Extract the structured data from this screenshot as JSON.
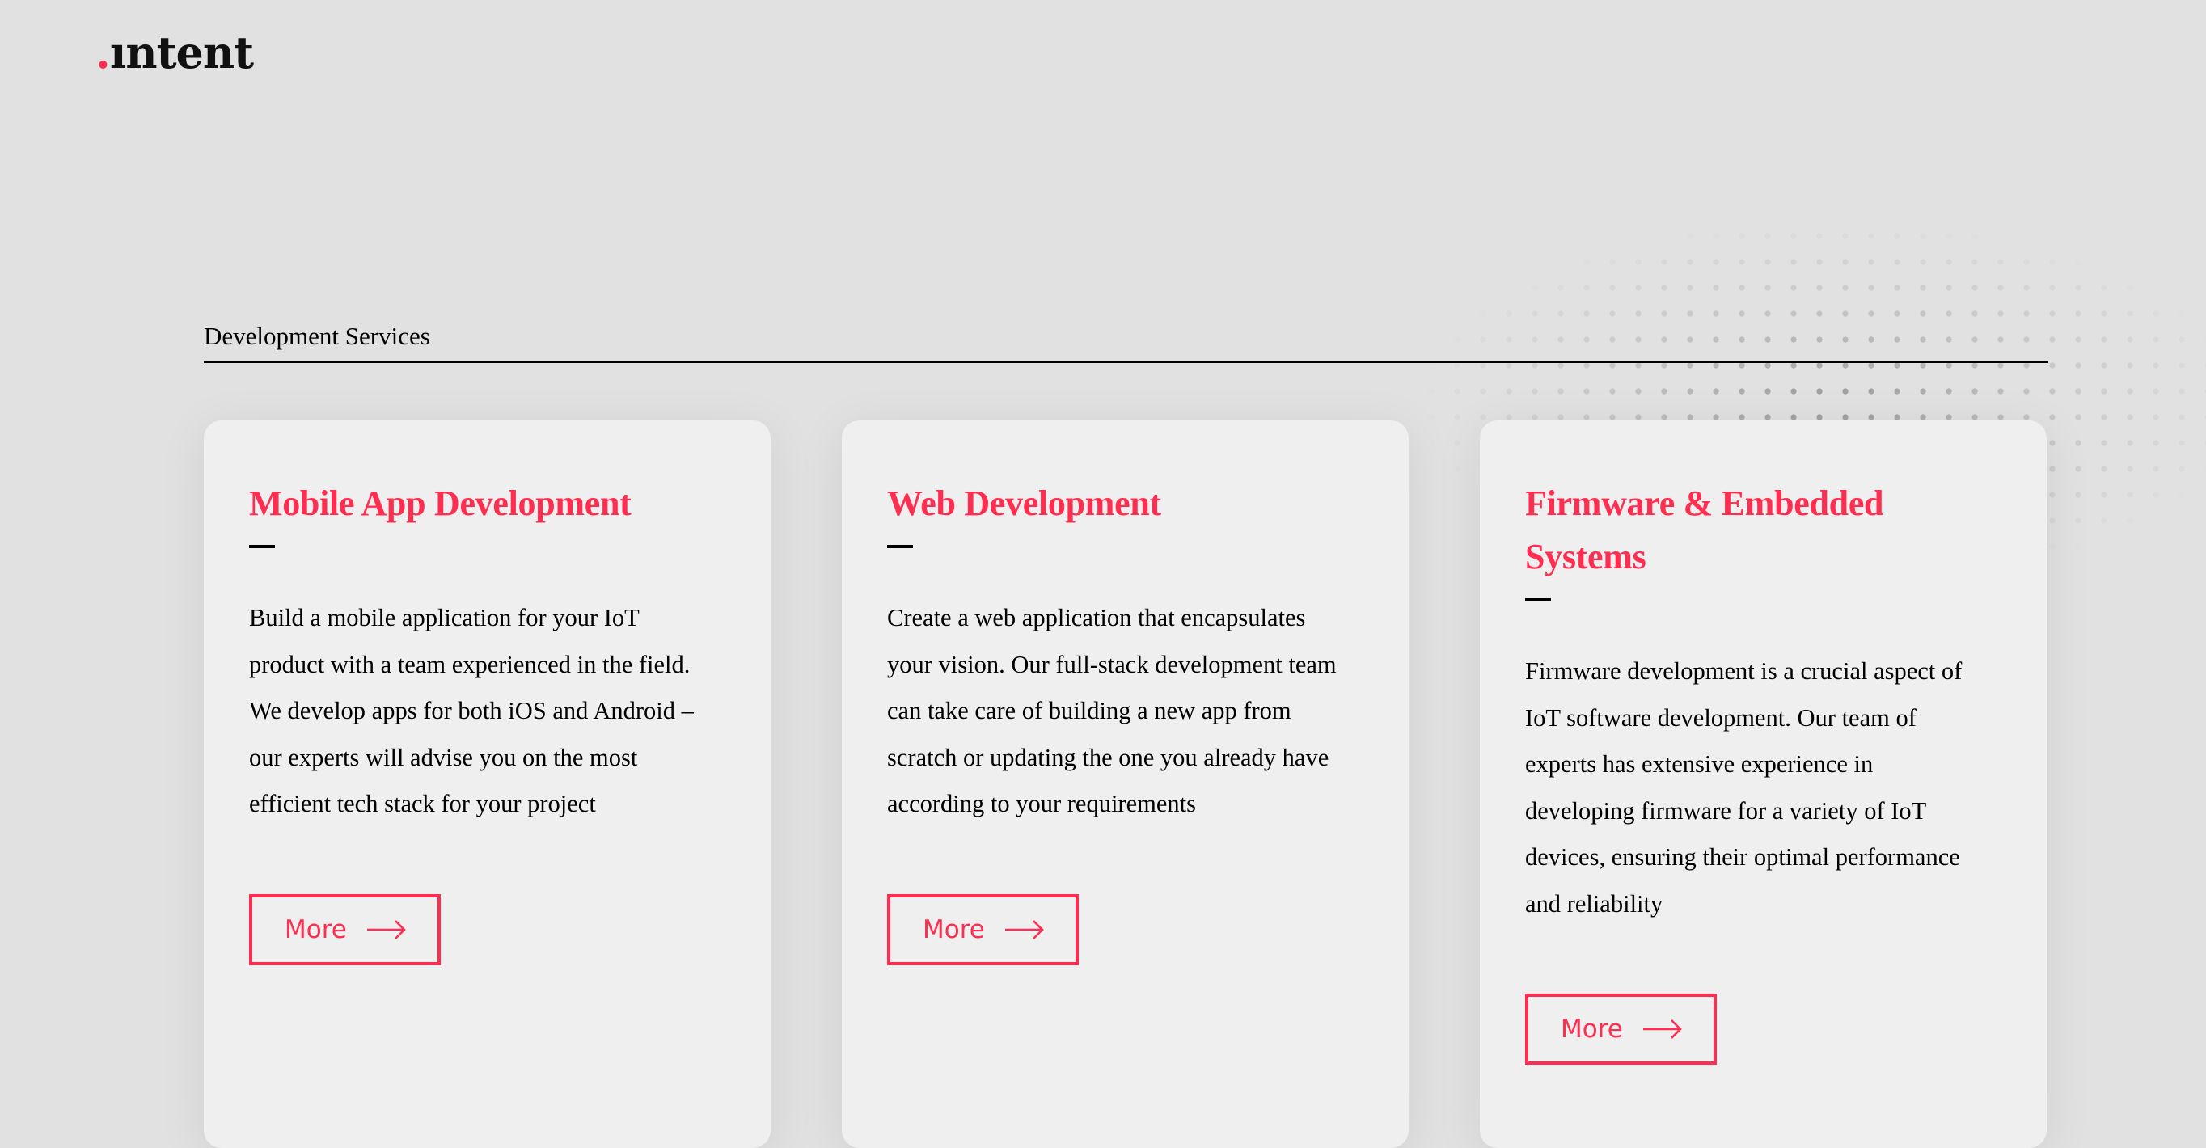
{
  "brand": {
    "logo_dot": ".",
    "logo_text": "ıntent",
    "accent_color": "#ff2d50"
  },
  "section": {
    "title": "Development Services"
  },
  "cards": [
    {
      "title": "Mobile App Development",
      "body": "Build a mobile application for your IoT product with a team experienced in the field. We develop apps for both iOS and Android – our experts will advise you on the most efficient tech stack for your project",
      "button_label": "More",
      "button_icon": "arrow-right-icon"
    },
    {
      "title": "Web Development",
      "body": "Create a web application that encapsulates your vision. Our full-stack development team can take care of building a new app from scratch or updating the one you already have according to your requirements",
      "button_label": "More",
      "button_icon": "arrow-right-icon"
    },
    {
      "title": "Firmware & Embedded Systems",
      "body": "Firmware development is a crucial aspect of IoT software development.  Our team of experts has extensive experience in developing firmware for a variety of IoT devices, ensuring their optimal performance and reliability",
      "button_label": "More",
      "button_icon": "arrow-right-icon"
    }
  ]
}
